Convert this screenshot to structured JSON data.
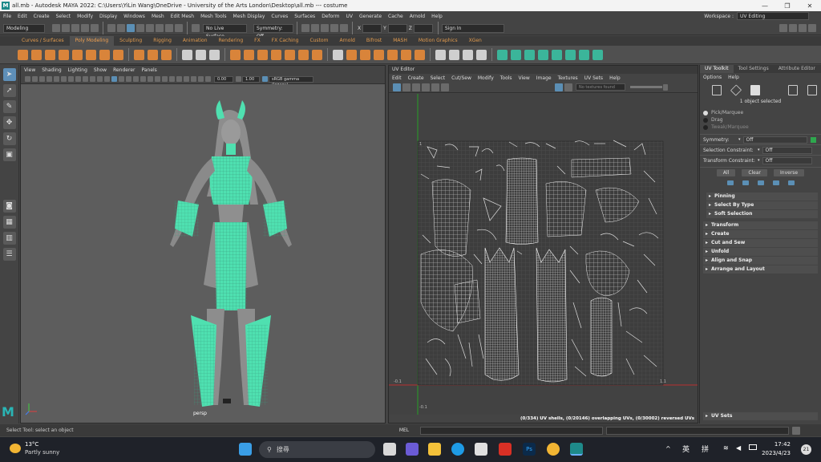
{
  "title_bar": {
    "logo": "M",
    "text": "all.mb - Autodesk MAYA 2022: C:\\Users\\YiLin Wang\\OneDrive - University of the Arts London\\Desktop\\all.mb   ---   costume",
    "minimize": "—",
    "maximize": "❐",
    "close": "✕"
  },
  "menu_bar": {
    "items": [
      "File",
      "Edit",
      "Create",
      "Select",
      "Modify",
      "Display",
      "Windows",
      "Mesh",
      "Edit Mesh",
      "Mesh Tools",
      "Mesh Display",
      "Curves",
      "Surfaces",
      "Deform",
      "UV",
      "Generate",
      "Cache",
      "Arnold",
      "Help"
    ],
    "workspace_label": "Workspace :",
    "workspace_value": "UV Editing"
  },
  "status_line": {
    "mode": "Modeling",
    "live_surface": "No Live Surface",
    "symmetry": "Symmetry: Off",
    "x_label": "X",
    "y_label": "Y",
    "z_label": "Z",
    "sign_in": "Sign In"
  },
  "shelf_tabs": [
    "Curves / Surfaces",
    "Poly Modeling",
    "Sculpting",
    "Rigging",
    "Animation",
    "Rendering",
    "FX",
    "FX Caching",
    "Custom",
    "Arnold",
    "Bifrost",
    "MASH",
    "Motion Graphics",
    "XGen"
  ],
  "shelf_active": "Poly Modeling",
  "viewport": {
    "menu": [
      "View",
      "Shading",
      "Lighting",
      "Show",
      "Renderer",
      "Panels"
    ],
    "field_a": "0.00",
    "field_b": "1.00",
    "colorspace": "sRGB gamma (legacy)",
    "camera_label": "persp"
  },
  "uv_editor": {
    "title": "UV Editor",
    "menu": [
      "Edit",
      "Create",
      "Select",
      "Cut/Sew",
      "Modify",
      "Tools",
      "View",
      "Image",
      "Textures",
      "UV Sets",
      "Help"
    ],
    "texture": "No textures found",
    "tick_top": "1",
    "tick_left": "0",
    "tick_right": "1.1",
    "tick_bottom_left": "-0.1",
    "tick_bottom": "-0.1",
    "status": "(0/334) UV shells, (0/20146) overlapping UVs, (0/30002) reversed UVs"
  },
  "uv_toolkit": {
    "tabs": [
      "UV Toolkit",
      "Tool Settings",
      "Attribute Editor"
    ],
    "menu": [
      "Options",
      "Help"
    ],
    "selected_info": "1 object selected",
    "modes": [
      "Pick/Marquee",
      "Drag",
      "Tweak/Marquee"
    ],
    "symmetry_label": "Symmetry:",
    "symmetry_value": "Off",
    "selection_constraint_label": "Selection Constraint:",
    "selection_constraint_value": "Off",
    "transform_constraint_label": "Transform Constraint:",
    "transform_constraint_value": "Off",
    "buttons": [
      "All",
      "Clear",
      "Inverse"
    ],
    "sub_sections": [
      "Pinning",
      "Select By Type",
      "Soft Selection"
    ],
    "sections": [
      "Transform",
      "Create",
      "Cut and Sew",
      "Unfold",
      "Align and Snap",
      "Arrange and Layout"
    ],
    "footer_section": "UV Sets"
  },
  "help_line": "Select Tool: select an object",
  "command_line": {
    "label": "MEL"
  },
  "taskbar": {
    "temperature": "13°C",
    "weather": "Partly sunny",
    "search": "搜尋",
    "lang1": "英",
    "lang2": "拼",
    "time": "17:42",
    "date": "2023/4/23",
    "notif": "21"
  },
  "colors": {
    "wire": "#4fe0b0",
    "uv_wire": "#e8e8e8",
    "accent": "#d9843a"
  }
}
